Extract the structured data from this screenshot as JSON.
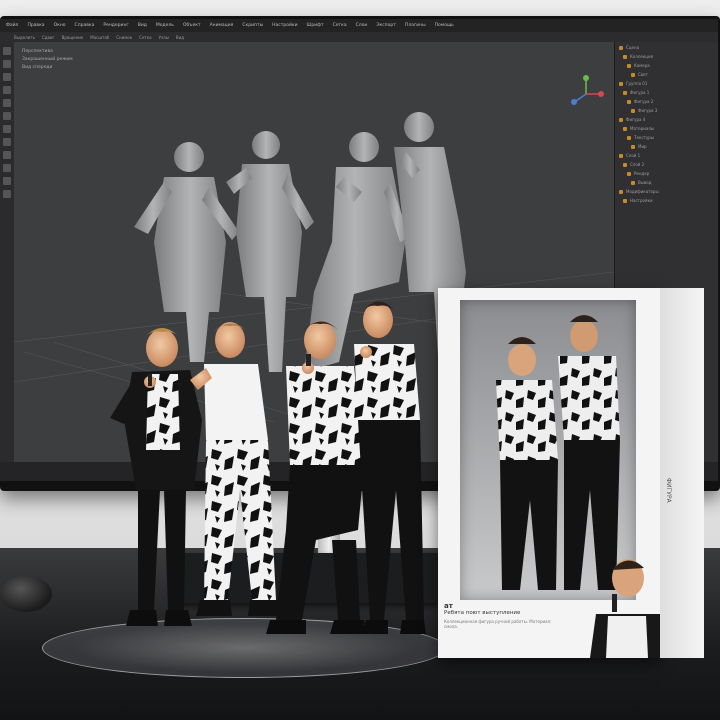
{
  "app": {
    "menu": [
      "Файл",
      "Правка",
      "Окно",
      "Справка",
      "Рендеринг",
      "Вид",
      "Модель",
      "Объект",
      "Анимация",
      "Скрипты",
      "Настройки",
      "Шрифт",
      "Сетка",
      "Слои",
      "Экспорт",
      "Плагины",
      "Помощь"
    ],
    "toolbar": [
      "Выделить",
      "Сдвиг",
      "Вращение",
      "Масштаб",
      "Снимок",
      "Сетка",
      "Узлы",
      "Вид"
    ],
    "viewport_labels": [
      "Перспектива",
      "Закрашенный режим",
      "Вид спереди"
    ],
    "outliner_rows": [
      "Сцена",
      "Коллекция",
      "Камера",
      "Свет",
      "Группа 01",
      "Фигура 1",
      "Фигура 2",
      "Фигура 3",
      "Фигура 4",
      "Материалы",
      "Текстуры",
      "Мир",
      "Слой 1",
      "Слой 2",
      "Рендер",
      "Вывод",
      "Модификаторы",
      "Настройки"
    ]
  },
  "box": {
    "brand": "ат",
    "title": "Ребята поют выступление",
    "subtitle": "Коллекционная фигура ручной работы. Материал: смола.",
    "side_label": "ФИГУРА"
  },
  "colors": {
    "screen": "#3d3e40",
    "accent": "#c48a2b",
    "desk": "#1b1c1e"
  }
}
